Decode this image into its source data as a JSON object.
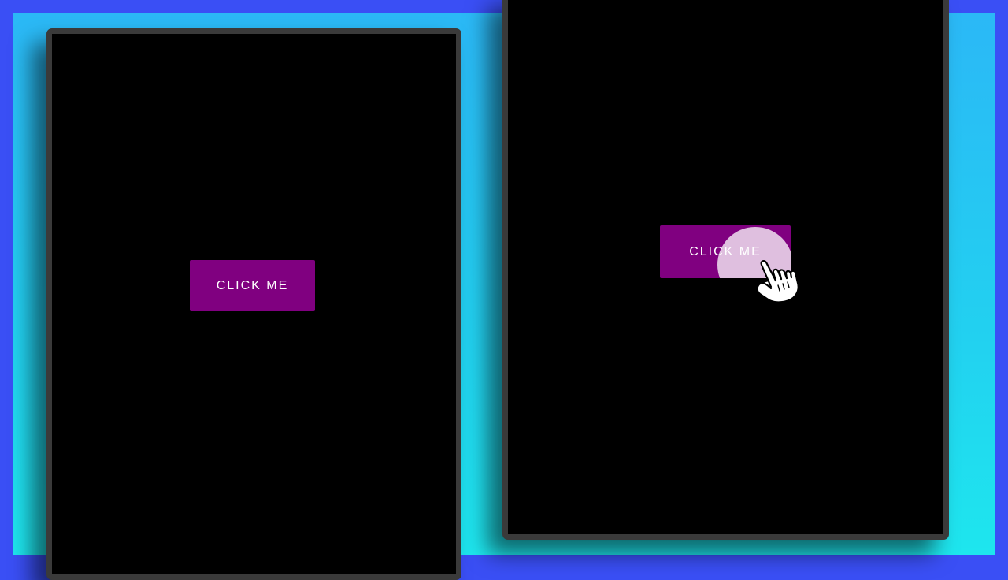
{
  "left_panel": {
    "button_label": "CLICK ME"
  },
  "right_panel": {
    "button_label": "CLICK ME",
    "state": "pressed-with-ripple"
  },
  "colors": {
    "page_border": "#3a4ff5",
    "background_top": "#2bb8f6",
    "background_bottom": "#1ee6ee",
    "panel_frame": "#3a3a3a",
    "panel_fill": "#000000",
    "button_fill": "#800080",
    "button_text": "#ffffff",
    "ripple": "rgba(255,255,255,0.75)"
  },
  "icons": {
    "cursor": "hand-pointer-icon"
  }
}
